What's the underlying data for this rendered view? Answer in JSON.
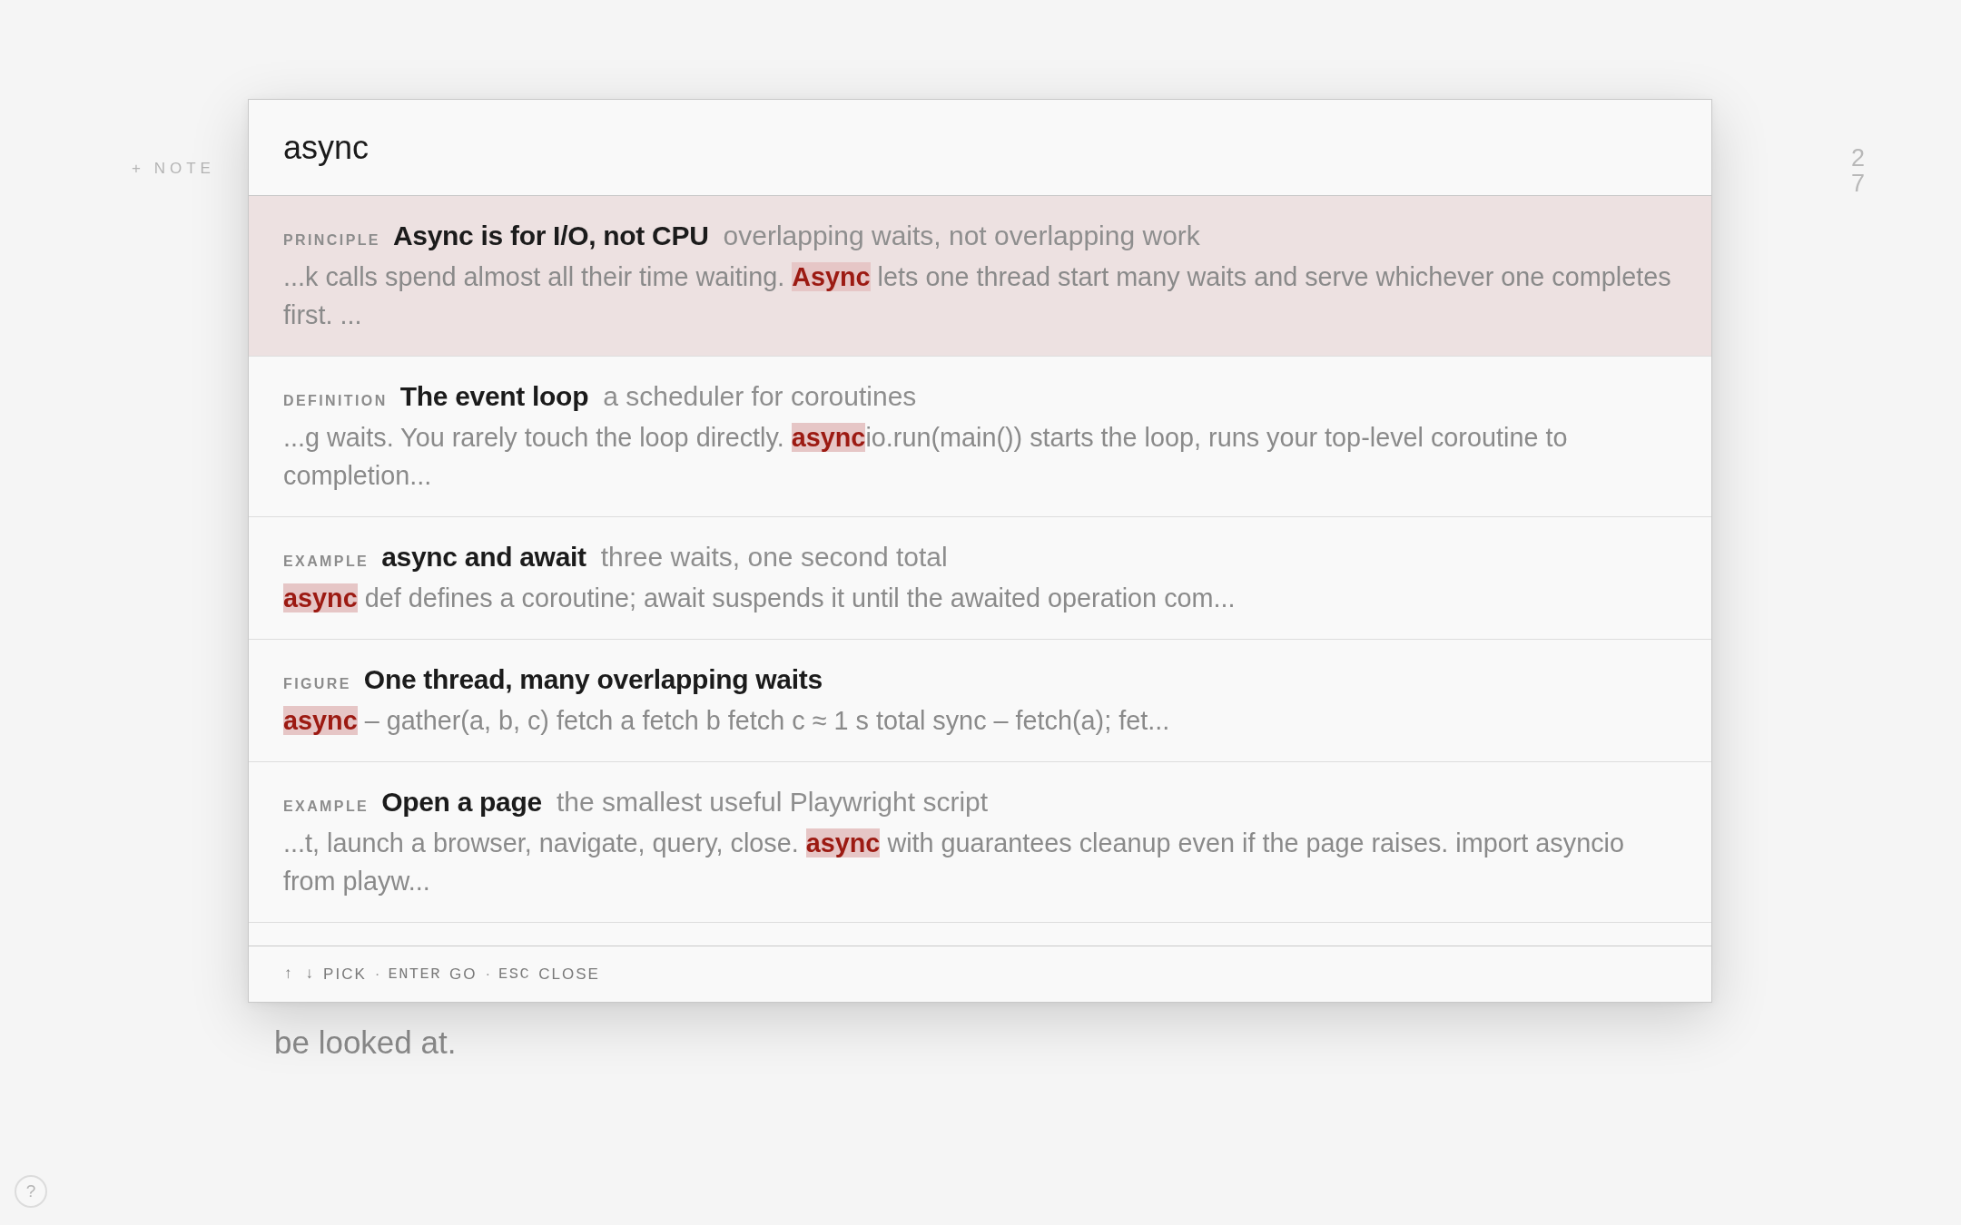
{
  "background": {
    "note_button": "+ NOTE",
    "page_number": "27",
    "paragraph_tail": "be looked at.",
    "help_button": "?"
  },
  "palette": {
    "query": "async",
    "results": [
      {
        "kind_label": "PRINCIPLE",
        "title": "Async is for I/O, not CPU",
        "subtitle": "overlapping waits, not overlapping work",
        "snippet": "...k calls spend almost all their time waiting. **Async** lets one thread start many waits and serve whichever one completes first. ...",
        "selected": true
      },
      {
        "kind_label": "DEFINITION",
        "title": "The event loop",
        "subtitle": "a scheduler for coroutines",
        "snippet": "...g waits. You rarely touch the loop directly. **async**io.run(main()) starts the loop, runs your top-level coroutine to completion...",
        "selected": false
      },
      {
        "kind_label": "EXAMPLE",
        "title": "async and await",
        "subtitle": "three waits, one second total",
        "snippet": "**async** def defines a coroutine; await suspends it until the awaited operation com...",
        "selected": false
      },
      {
        "kind_label": "FIGURE",
        "title": "One thread, many overlapping waits",
        "snippet": "**async** – gather(a, b, c) fetch a fetch b fetch c ≈ 1 s total sync – fetch(a); fet...",
        "selected": false
      },
      {
        "kind_label": "EXAMPLE",
        "title": "Open a page",
        "subtitle": "the smallest useful Playwright script",
        "snippet": "...t, launch a browser, navigate, query, close. **async** with guarantees cleanup even if the page raises. import asyncio from playw...",
        "selected": false
      }
    ],
    "footer": {
      "separator": "·",
      "hints": [
        {
          "keys": "↑ ↓",
          "action": "PICK"
        },
        {
          "keys": "ENTER",
          "action": "GO"
        },
        {
          "keys": "ESC",
          "action": "CLOSE"
        }
      ]
    }
  }
}
